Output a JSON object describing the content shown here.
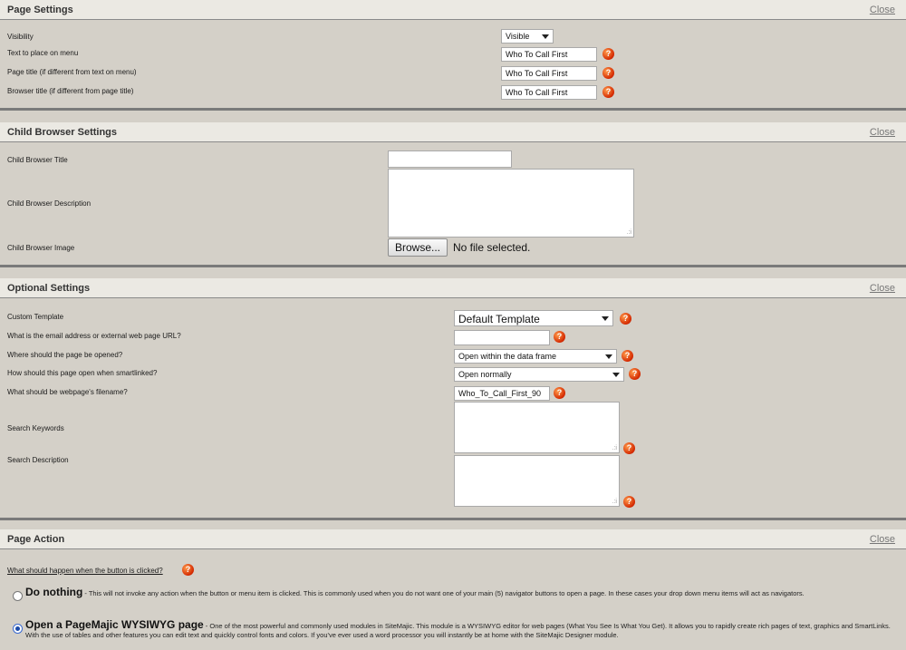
{
  "page_settings": {
    "title": "Page Settings",
    "close": "Close",
    "visibility_label": "Visibility",
    "visibility_value": "Visible",
    "menu_text_label": "Text to place on menu",
    "menu_text_value": "Who To Call First",
    "page_title_label": "Page title (if different from text on menu)",
    "page_title_value": "Who To Call First",
    "browser_title_label": "Browser title (if different from page title)",
    "browser_title_value": "Who To Call First"
  },
  "child_browser": {
    "title": "Child Browser Settings",
    "close": "Close",
    "cb_title_label": "Child Browser Title",
    "cb_title_value": "",
    "cb_desc_label": "Child Browser Description",
    "cb_image_label": "Child Browser Image",
    "browse_label": "Browse...",
    "no_file_label": "No file selected."
  },
  "optional": {
    "title": "Optional Settings",
    "close": "Close",
    "template_label": "Custom Template",
    "template_value": "Default Template",
    "url_label": "What is the email address or external web page URL?",
    "url_value": "",
    "open_where_label": "Where should the page be opened?",
    "open_where_value": "Open within the data frame",
    "smartlink_label": "How should this page open when smartlinked?",
    "smartlink_value": "Open normally",
    "filename_label": "What should be webpage's filename?",
    "filename_value": "Who_To_Call_First_90",
    "keywords_label": "Search Keywords",
    "description_label": "Search Description"
  },
  "page_action": {
    "title": "Page Action",
    "close": "Close",
    "question": "What should happen when the button is clicked?",
    "options": [
      {
        "title": "Do nothing",
        "desc": " - This will not invoke any action when the button or menu item is clicked. This is commonly used when you do not want one of your main (5) navigator buttons to open a page. In these cases your drop down menu items will act as navigators.",
        "checked": false
      },
      {
        "title": "Open a PageMajic WYSIWYG page",
        "desc": " - One of the most powerful and commonly used modules in SiteMajic. This module is a WYSIWYG editor for web pages (What You See Is What You Get). It allows you to rapidly create rich pages of text, graphics and SmartLinks. With the use of tables and other features you can edit text and quickly control fonts and colors. If you've ever used a word processor you will instantly be at home with the SiteMajic Designer module.",
        "checked": true
      }
    ]
  },
  "icons": {
    "help": "help-question-icon"
  },
  "colors": {
    "panel_bg": "#d4d0c8",
    "header_bg": "#ebe9e3",
    "help_icon": "#d42800",
    "radio_selected": "#1a4aa8"
  }
}
